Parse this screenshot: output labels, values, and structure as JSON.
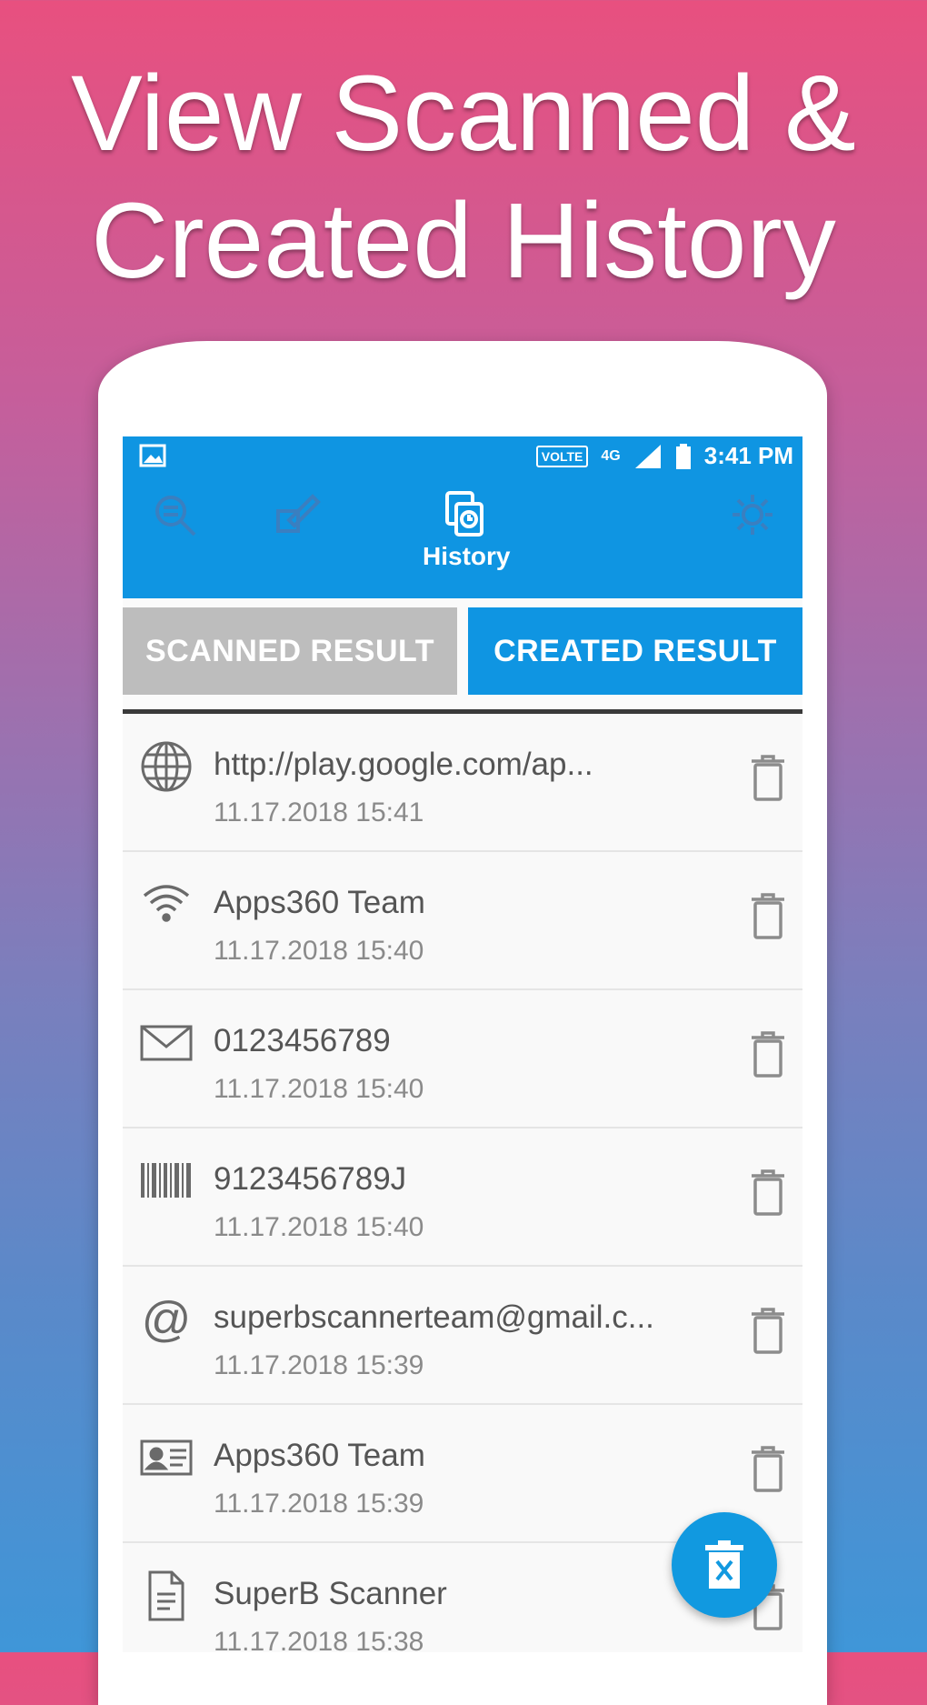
{
  "promo": {
    "line1": "View Scanned &",
    "line2": "Created History"
  },
  "status_bar": {
    "badge": "VOLTE",
    "network": "4G",
    "time": "3:41 PM"
  },
  "nav": {
    "active_label": "History",
    "icons": [
      "scan-icon",
      "create-icon",
      "history-icon",
      "settings-icon"
    ]
  },
  "tabs": {
    "scanned": "SCANNED RESULT",
    "created": "CREATED RESULT",
    "active": "created"
  },
  "history": [
    {
      "icon": "globe-icon",
      "title": "http://play.google.com/ap...",
      "time": "11.17.2018 15:41"
    },
    {
      "icon": "wifi-icon",
      "title": "Apps360 Team",
      "time": "11.17.2018 15:40"
    },
    {
      "icon": "email-icon",
      "title": "0123456789",
      "time": "11.17.2018 15:40"
    },
    {
      "icon": "barcode-icon",
      "title": "9123456789J",
      "time": "11.17.2018 15:40"
    },
    {
      "icon": "at-icon",
      "title": "superbscannerteam@gmail.c...",
      "time": "11.17.2018 15:39"
    },
    {
      "icon": "contact-card-icon",
      "title": "Apps360 Team",
      "time": "11.17.2018 15:39"
    },
    {
      "icon": "document-icon",
      "title": "SuperB Scanner",
      "time": "11.17.2018 15:38"
    }
  ],
  "colors": {
    "primary": "#0f95e2",
    "inactive_tab": "#bdbdbd"
  }
}
